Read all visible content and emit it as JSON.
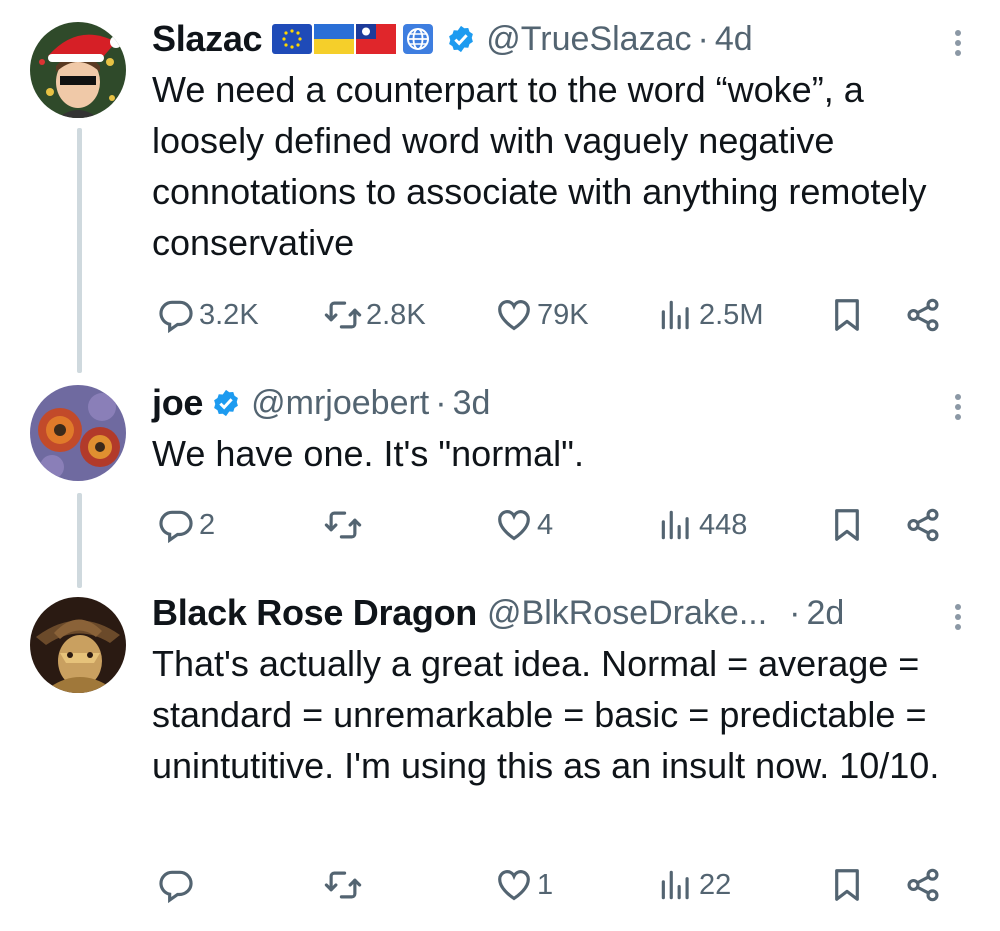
{
  "tweets": [
    {
      "name": "Slazac",
      "handle": "@TrueSlazac",
      "time": "4d",
      "text": "We need a counterpart to the word “woke”, a loosely defined word with vaguely negative connotations to associate with anything remotely conservative",
      "replies": "3.2K",
      "reposts": "2.8K",
      "likes": "79K",
      "views": "2.5M"
    },
    {
      "name": "joe",
      "handle": "@mrjoebert",
      "time": "3d",
      "text": "We have one. It's \"normal\".",
      "replies": "2",
      "reposts": "",
      "likes": "4",
      "views": "448"
    },
    {
      "name": "Black Rose Dragon",
      "handle": "@BlkRoseDrake...",
      "time": "2d",
      "text": "That's actually a great idea. Normal = average = standard = unremarkable = basic = predictable = unintutitive. I'm using this as an insult now. 10/10.",
      "replies": "",
      "reposts": "",
      "likes": "1",
      "views": "22"
    }
  ],
  "separator": "·",
  "icons": {
    "reply": "reply-bubble-icon",
    "repost": "repost-icon",
    "like": "heart-icon",
    "views": "views-bar-icon",
    "bookmark": "bookmark-icon",
    "share": "share-icon",
    "verified": "verified-badge-icon",
    "more": "more-vertical-icon"
  },
  "colors": {
    "text": "#0f1419",
    "secondary": "#536471",
    "verified": "#1d9bf0",
    "thread_line": "#cfd9de"
  }
}
